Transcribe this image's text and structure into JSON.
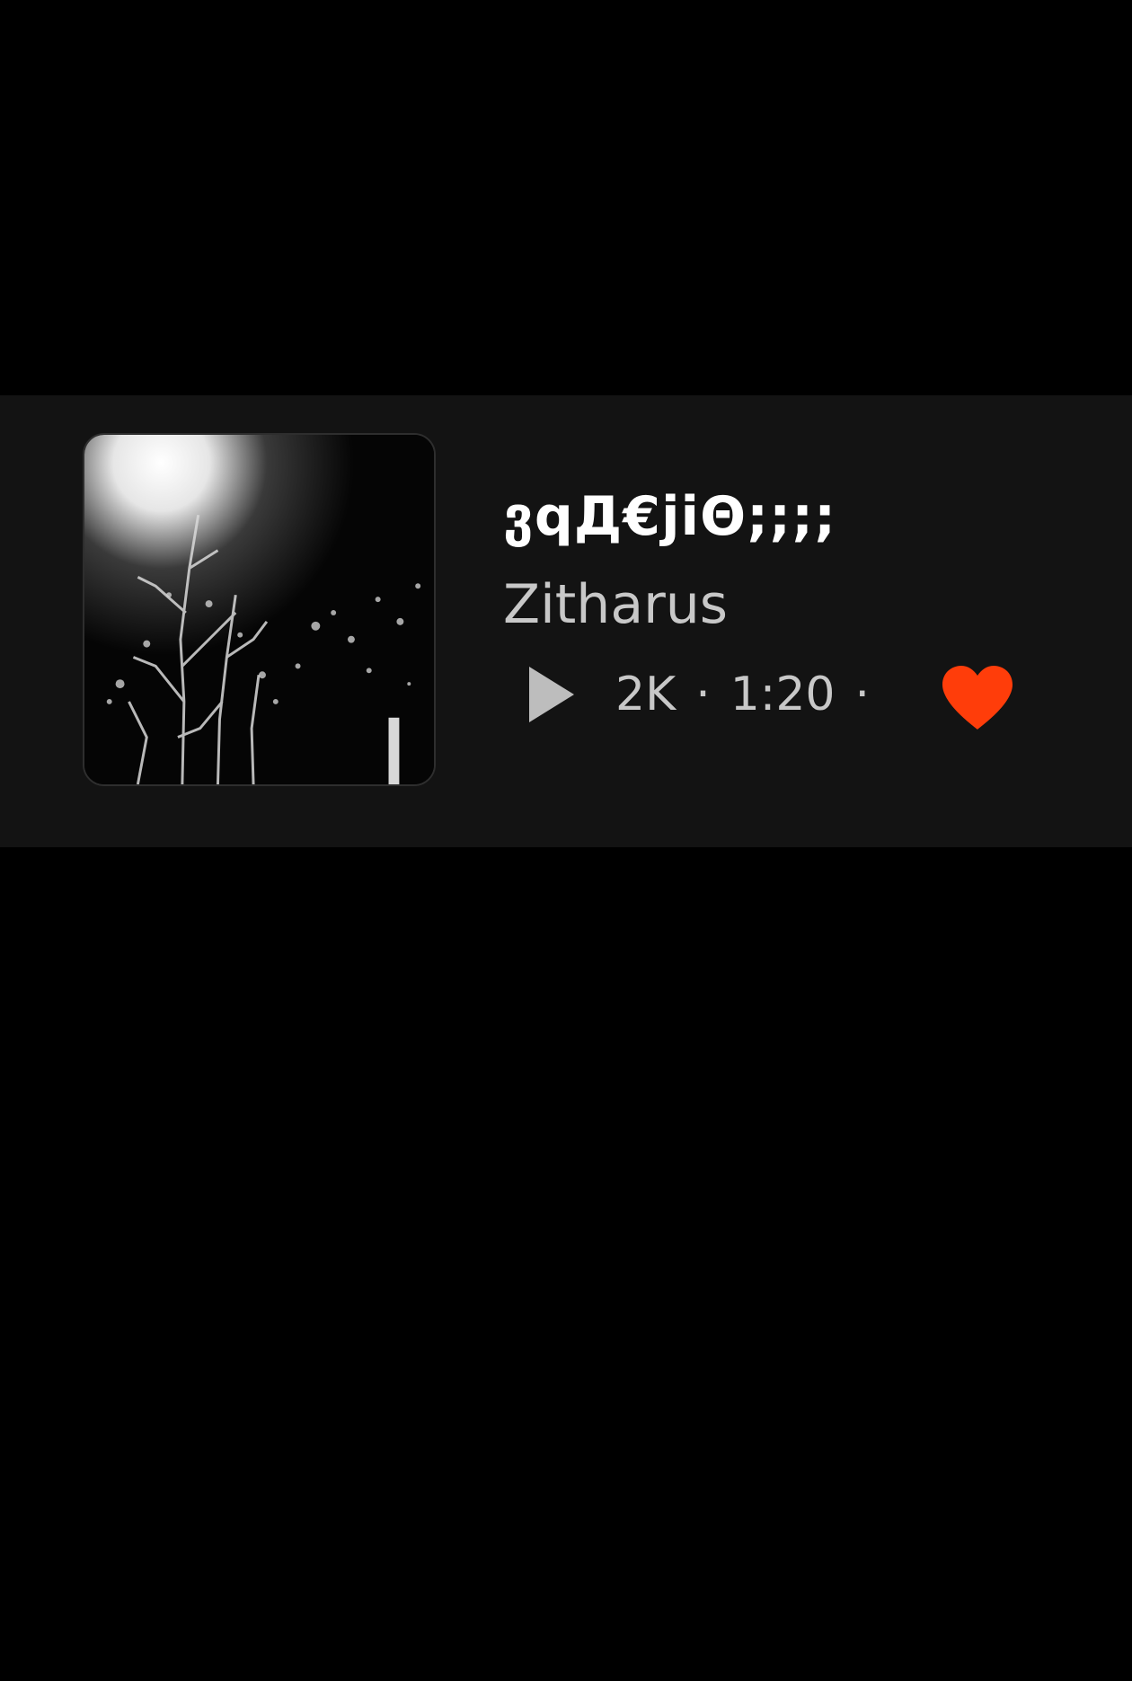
{
  "track": {
    "title": "ვqД€jiΘ;;;;",
    "artist": "Zitharus",
    "plays": "2K",
    "separator": "·",
    "duration": "1:20",
    "liked": true
  },
  "icons": {
    "play": "play-icon",
    "like": "heart-icon"
  },
  "colors": {
    "background": "#000000",
    "card": "#131313",
    "title": "#ffffff",
    "secondary_text": "#c8c8c8",
    "play_icon": "#bdbdbd",
    "heart": "#ff3d0a"
  }
}
